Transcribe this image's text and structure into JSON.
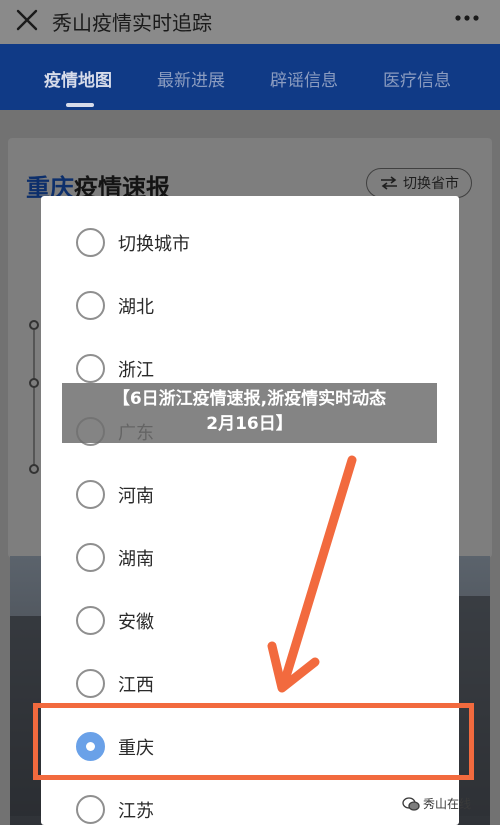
{
  "app_bar": {
    "title": "秀山疫情实时追踪"
  },
  "tabs": [
    {
      "label": "疫情地图",
      "active": true
    },
    {
      "label": "最新进展",
      "active": false
    },
    {
      "label": "辟谣信息",
      "active": false
    },
    {
      "label": "医疗信息",
      "active": false
    }
  ],
  "section": {
    "title_highlight": "重庆",
    "title_rest": "疫情速报",
    "switch_label": "切换省市"
  },
  "dialog": {
    "options": [
      {
        "label": "切换城市",
        "checked": false
      },
      {
        "label": "湖北",
        "checked": false
      },
      {
        "label": "浙江",
        "checked": false
      },
      {
        "label": "广东",
        "checked": false
      },
      {
        "label": "河南",
        "checked": false
      },
      {
        "label": "湖南",
        "checked": false
      },
      {
        "label": "安徽",
        "checked": false
      },
      {
        "label": "江西",
        "checked": false
      },
      {
        "label": "重庆",
        "checked": true
      },
      {
        "label": "江苏",
        "checked": false
      }
    ]
  },
  "overlay": {
    "line1": "【6日浙江疫情速报,浙​疫情实时动态",
    "line2": "2月16日】"
  },
  "watermark": {
    "text": "秀山在线"
  },
  "colors": {
    "tab_bar": "#103a86",
    "radio_checked": "#6aa1e8",
    "annotation": "#f26a3e"
  }
}
